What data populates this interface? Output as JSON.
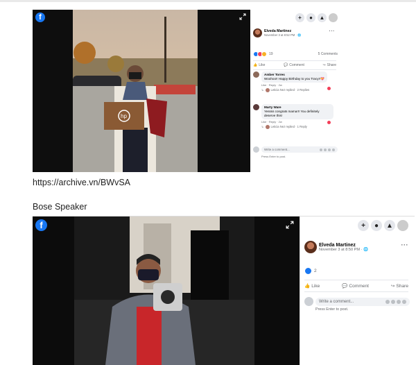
{
  "posts": [
    {
      "author": "Elveda Martinez",
      "date": "November 3 at 8:52 PM · 🌐",
      "reaction_count": "19",
      "comment_count": "5 Comments",
      "actions": {
        "like": "Like",
        "comment": "Comment",
        "share": "Share"
      },
      "comments": [
        {
          "name": "Amber Torres",
          "text": "Woohoo!! Happy Birthday to you Tracy!!💝",
          "meta": "Like · Reply · 2w",
          "reply": "Leticia Nez replied · 2 Replies"
        },
        {
          "name": "Marty Ware",
          "text": "Yessss congrats mama!!! You definitely deserve this!",
          "meta": "Like · Reply · 2w",
          "reply": "Leticia Nez replied · 1 Reply"
        }
      ],
      "write_placeholder": "Write a comment...",
      "press_enter": "Press Enter to post."
    },
    {
      "author": "Elveda Martinez",
      "date": "November 3 at 8:50 PM · 🌐",
      "reaction_count": "2",
      "actions": {
        "like": "Like",
        "comment": "Comment",
        "share": "Share"
      },
      "write_placeholder": "Write a comment...",
      "press_enter": "Press Enter to post."
    }
  ],
  "captions": {
    "archive_url": "https://archive.vn/BWvSA",
    "section_title": "Bose Speaker"
  },
  "colors": {
    "facebook_blue": "#1877f2",
    "reaction_like": "#1877f2",
    "reaction_love": "#f33e58",
    "reaction_haha": "#f7b125"
  },
  "icons": {
    "brand": "facebook-icon",
    "expand": "expand-icon",
    "header": [
      "plus-icon",
      "messenger-icon",
      "bell-icon",
      "profile-avatar"
    ],
    "more": "more-options-icon"
  }
}
